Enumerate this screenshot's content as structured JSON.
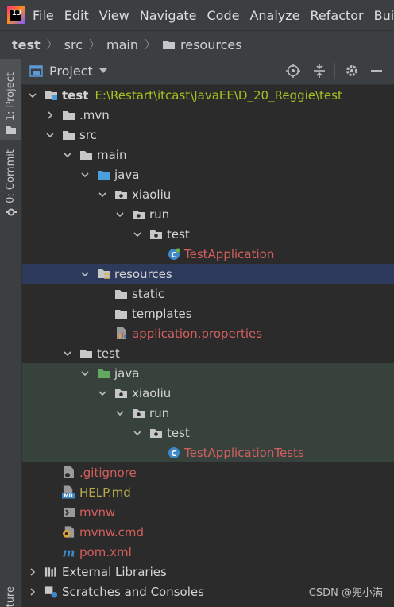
{
  "menu": [
    "File",
    "Edit",
    "View",
    "Navigate",
    "Code",
    "Analyze",
    "Refactor",
    "Build"
  ],
  "breadcrumb": [
    "test",
    "src",
    "main",
    "resources"
  ],
  "stripe": {
    "project": "1: Project",
    "commit": "0: Commit",
    "structure": "ture"
  },
  "panel": {
    "title": "Project"
  },
  "tree": [
    {
      "label": "test",
      "detail": "E:\\Restart\\itcast\\JavaEE\\D_20_Reggie\\test",
      "icon": "module-icon",
      "arrow": "down",
      "depth": 0,
      "color": "bold"
    },
    {
      "label": ".mvn",
      "icon": "folder-icon",
      "arrow": "right",
      "depth": 1,
      "color": "dir"
    },
    {
      "label": "src",
      "icon": "folder-icon",
      "arrow": "down",
      "depth": 1,
      "color": "dir"
    },
    {
      "label": "main",
      "icon": "folder-icon",
      "arrow": "down",
      "depth": 2,
      "color": "dir"
    },
    {
      "label": "java",
      "icon": "source-folder-icon",
      "arrow": "down",
      "depth": 3,
      "color": "dir"
    },
    {
      "label": "xiaoliu",
      "icon": "package-icon",
      "arrow": "down",
      "depth": 4,
      "color": "dir"
    },
    {
      "label": "run",
      "icon": "package-icon",
      "arrow": "down",
      "depth": 5,
      "color": "dir"
    },
    {
      "label": "test",
      "icon": "package-icon",
      "arrow": "down",
      "depth": 6,
      "color": "dir"
    },
    {
      "label": "TestApplication",
      "icon": "spring-class-icon",
      "arrow": "none",
      "depth": 7,
      "color": "red"
    },
    {
      "label": "resources",
      "icon": "resources-folder-icon",
      "arrow": "down",
      "depth": 3,
      "color": "dir",
      "selected": true
    },
    {
      "label": "static",
      "icon": "folder-icon",
      "arrow": "none",
      "depth": 4,
      "color": "dir"
    },
    {
      "label": "templates",
      "icon": "folder-icon",
      "arrow": "none",
      "depth": 4,
      "color": "dir"
    },
    {
      "label": "application.properties",
      "icon": "properties-file-icon",
      "arrow": "none",
      "depth": 4,
      "color": "red"
    },
    {
      "label": "test",
      "icon": "folder-icon",
      "arrow": "down",
      "depth": 2,
      "color": "dir"
    },
    {
      "label": "java",
      "icon": "test-source-folder-icon",
      "arrow": "down",
      "depth": 3,
      "color": "dir"
    },
    {
      "label": "xiaoliu",
      "icon": "package-icon",
      "arrow": "down",
      "depth": 4,
      "color": "dir"
    },
    {
      "label": "run",
      "icon": "package-icon",
      "arrow": "down",
      "depth": 5,
      "color": "dir"
    },
    {
      "label": "test",
      "icon": "package-icon",
      "arrow": "down",
      "depth": 6,
      "color": "dir"
    },
    {
      "label": "TestApplicationTests",
      "icon": "class-icon",
      "arrow": "none",
      "depth": 7,
      "color": "red"
    },
    {
      "label": ".gitignore",
      "icon": "gitignore-file-icon",
      "arrow": "none",
      "depth": 1,
      "color": "red"
    },
    {
      "label": "HELP.md",
      "icon": "markdown-file-icon",
      "arrow": "none",
      "depth": 1,
      "color": "olive"
    },
    {
      "label": "mvnw",
      "icon": "shell-file-icon",
      "arrow": "none",
      "depth": 1,
      "color": "red"
    },
    {
      "label": "mvnw.cmd",
      "icon": "cmd-file-icon",
      "arrow": "none",
      "depth": 1,
      "color": "red"
    },
    {
      "label": "pom.xml",
      "icon": "maven-file-icon",
      "arrow": "none",
      "depth": 1,
      "color": "red"
    },
    {
      "label": "External Libraries",
      "icon": "libraries-icon",
      "arrow": "right",
      "depth": 0,
      "color": "dir"
    },
    {
      "label": "Scratches and Consoles",
      "icon": "scratches-icon",
      "arrow": "right",
      "depth": 0,
      "color": "dir"
    }
  ],
  "watermark": "CSDN @兜小满",
  "colors": {
    "selection": "#2d3a5c",
    "test_bg": "#38423c",
    "label_red": "#d45f5f",
    "label_olive": "#b7a94c",
    "path_green": "#a8c023"
  }
}
